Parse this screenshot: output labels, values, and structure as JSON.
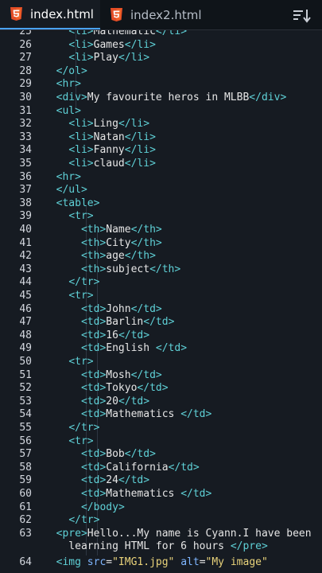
{
  "tabs": [
    {
      "label": "index.html",
      "active": true
    },
    {
      "label": "index2.html",
      "active": false
    }
  ],
  "menu_icon": "sort-lines-icon",
  "colors": {
    "tag": "#5fd1d7",
    "text": "#e6e6e6",
    "attr": "#7fb6ff",
    "string": "#e8d27a",
    "html5": "#e44d26"
  },
  "lines": [
    {
      "n": "25",
      "code": "    <li>Mathematic</li>"
    },
    {
      "n": "26",
      "code": "    <li>Games</li>"
    },
    {
      "n": "27",
      "code": "    <li>Play</li>"
    },
    {
      "n": "28",
      "code": "  </ol>"
    },
    {
      "n": "29",
      "code": "  <hr>"
    },
    {
      "n": "30",
      "code": "  <div>My favourite heros in MLBB</div>"
    },
    {
      "n": "31",
      "code": "  <ul>"
    },
    {
      "n": "32",
      "code": "    <li>Ling</li>"
    },
    {
      "n": "33",
      "code": "    <li>Natan</li>"
    },
    {
      "n": "34",
      "code": "    <li>Fanny</li>"
    },
    {
      "n": "35",
      "code": "    <li>claud</li>"
    },
    {
      "n": "36",
      "code": "  <hr>"
    },
    {
      "n": "37",
      "code": "  </ul>"
    },
    {
      "n": "38",
      "code": "  <table>"
    },
    {
      "n": "39",
      "code": "    <tr>"
    },
    {
      "n": "40",
      "code": "      <th>Name</th>"
    },
    {
      "n": "41",
      "code": "      <th>City</th>"
    },
    {
      "n": "42",
      "code": "      <th>age</th>"
    },
    {
      "n": "43",
      "code": "      <th>subject</th>"
    },
    {
      "n": "44",
      "code": "    </tr>"
    },
    {
      "n": "45",
      "code": "    <tr>"
    },
    {
      "n": "46",
      "code": "      <td>John</td>"
    },
    {
      "n": "47",
      "code": "      <td>Barlin</td>"
    },
    {
      "n": "48",
      "code": "      <td>16</td>"
    },
    {
      "n": "49",
      "code": "      <td>English </td>"
    },
    {
      "n": "50",
      "code": "    <tr>"
    },
    {
      "n": "51",
      "code": "      <td>Mosh</td>"
    },
    {
      "n": "52",
      "code": "      <td>Tokyo</td>"
    },
    {
      "n": "53",
      "code": "      <td>20</td>"
    },
    {
      "n": "54",
      "code": "      <td>Mathematics </td>"
    },
    {
      "n": "55",
      "code": "    </tr>"
    },
    {
      "n": "56",
      "code": "    <tr>"
    },
    {
      "n": "57",
      "code": "      <td>Bob</td>"
    },
    {
      "n": "58",
      "code": "      <td>California</td>"
    },
    {
      "n": "59",
      "code": "      <td>24</td>"
    },
    {
      "n": "60",
      "code": "      <td>Mathematics </td>"
    },
    {
      "n": "61",
      "code": "      </body>"
    },
    {
      "n": "62",
      "code": "    </tr>"
    },
    {
      "n": "63",
      "code": "  <pre>Hello...My name is Cyann.I have been"
    },
    {
      "n": "",
      "code": "    learning HTML for 6 hours </pre>"
    },
    {
      "n": "64",
      "code": "  <img src=\"IMG1.jpg\" alt=\"My image\""
    }
  ]
}
